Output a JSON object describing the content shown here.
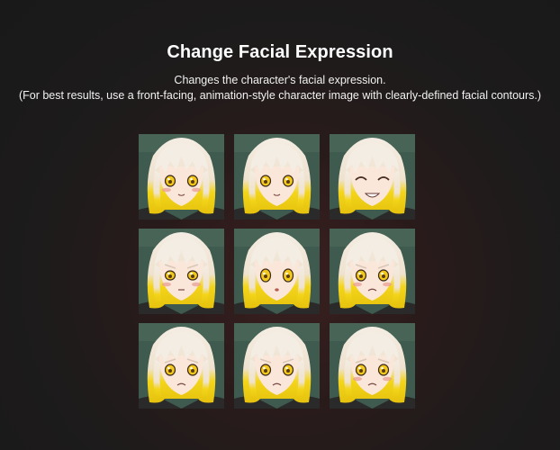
{
  "header": {
    "title": "Change Facial Expression",
    "subtitle_line1": "Changes the character's facial expression.",
    "subtitle_line2": "(For best results, use a front-facing, animation-style character image with clearly-defined facial contours.)"
  },
  "gallery": {
    "tiles": [
      {
        "expression": "neutral-blush"
      },
      {
        "expression": "neutral"
      },
      {
        "expression": "grin"
      },
      {
        "expression": "annoyed-blush"
      },
      {
        "expression": "surprised"
      },
      {
        "expression": "angry-blush"
      },
      {
        "expression": "worried"
      },
      {
        "expression": "frown"
      },
      {
        "expression": "embarrassed"
      }
    ]
  },
  "colors": {
    "background": "#1d1b1b",
    "tile_background": "#3f5a4e",
    "hair_top": "#f4ede3",
    "hair_tips": "#f3d51a",
    "eyes": "#f2c81a"
  }
}
